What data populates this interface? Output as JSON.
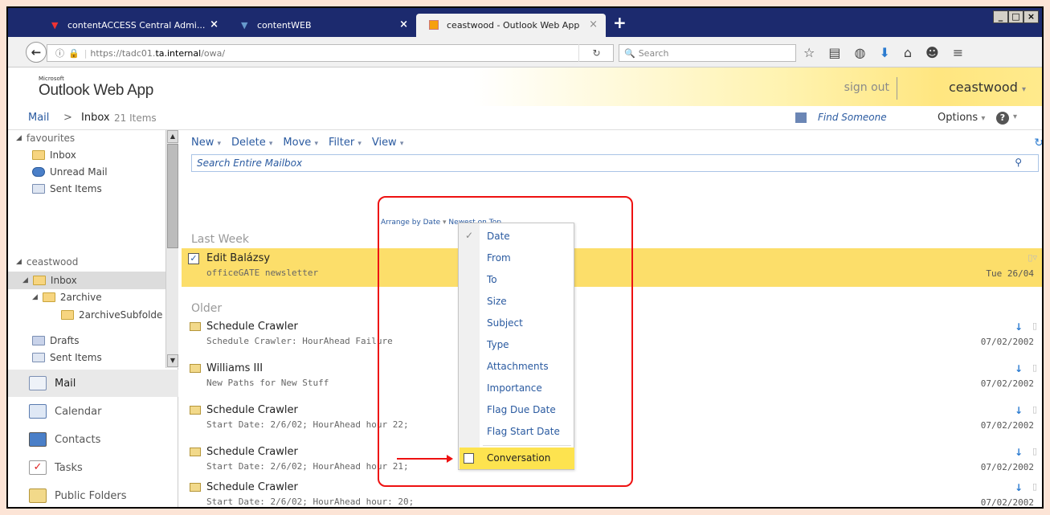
{
  "browser": {
    "tabs": [
      {
        "label": "contentACCESS Central Admi...",
        "close": "×"
      },
      {
        "label": "contentWEB",
        "close": "×"
      },
      {
        "label": "ceastwood - Outlook Web App",
        "close": "×"
      }
    ],
    "new_tab": "+",
    "url": {
      "prefix": "https://tadc01.",
      "domain": "ta.internal",
      "path": "/owa/"
    },
    "search_placeholder": "Search",
    "window_buttons": [
      "_",
      "□",
      "×"
    ]
  },
  "owa": {
    "brand_small": "Microsoft",
    "brand": "Outlook Web App",
    "sign_out": "sign out",
    "user": "ceastwood",
    "user_caret": "▾"
  },
  "crumbs": {
    "mail": "Mail",
    "sep": ">",
    "inbox": "Inbox",
    "count": "21 Items",
    "find_someone": "Find Someone",
    "options": "Options",
    "options_caret": "▾",
    "help": "?"
  },
  "folders": {
    "favourites": "favourites",
    "fav_inbox": "Inbox",
    "fav_unread": "Unread Mail",
    "fav_sent": "Sent Items",
    "account": "ceastwood",
    "inbox": "Inbox",
    "archive": "2archive",
    "archive_sub": "2archiveSubfolde",
    "drafts": "Drafts",
    "sent": "Sent Items"
  },
  "modules": [
    "Mail",
    "Calendar",
    "Contacts",
    "Tasks",
    "Public Folders"
  ],
  "toolbar": {
    "new": "New",
    "delete": "Delete",
    "move": "Move",
    "filter": "Filter",
    "view": "View",
    "caret": "▾",
    "search_placeholder": "Search Entire Mailbox"
  },
  "arrange": {
    "by": "Arrange by Date",
    "order": "Newest on Top"
  },
  "groups": {
    "last_week": "Last Week",
    "older": "Older"
  },
  "messages": [
    {
      "sender": "Edit Balázsy",
      "subject": "officeGATE newsletter",
      "date": "Tue 26/04",
      "selected": true
    },
    {
      "sender": "Schedule Crawler",
      "subject": "Schedule Crawler: HourAhead Failure",
      "date": "07/02/2002"
    },
    {
      "sender": "Williams III",
      "subject": "New Paths for New Stuff",
      "date": "07/02/2002"
    },
    {
      "sender": "Schedule Crawler",
      "subject": "Start Date: 2/6/02; HourAhead hour 22;",
      "date": "07/02/2002"
    },
    {
      "sender": "Schedule Crawler",
      "subject": "Start Date: 2/6/02; HourAhead hour 21;",
      "date": "07/02/2002"
    },
    {
      "sender": "Schedule Crawler",
      "subject": "Start Date: 2/6/02; HourAhead hour: 20;",
      "date": "07/02/2002"
    }
  ],
  "arrange_menu": {
    "items": [
      "Date",
      "From",
      "To",
      "Size",
      "Subject",
      "Type",
      "Attachments",
      "Importance",
      "Flag Due Date",
      "Flag Start Date"
    ],
    "checked": "Date",
    "conversation": "Conversation"
  },
  "colors": {
    "accent": "#2a5aa0",
    "highlight": "#fcde6a",
    "annotation": "#ee1111"
  }
}
